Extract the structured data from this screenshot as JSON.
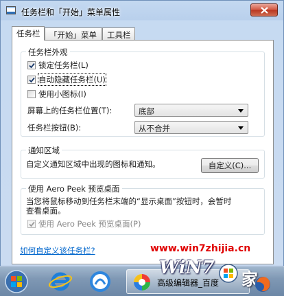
{
  "window": {
    "title": "任务栏和「开始」菜单属性"
  },
  "tabs": [
    {
      "label": "任务栏",
      "active": true
    },
    {
      "label": "「开始」菜单",
      "active": false
    },
    {
      "label": "工具栏",
      "active": false
    }
  ],
  "appearance": {
    "heading": "任务栏外观",
    "lock_taskbar": {
      "label": "锁定任务栏(L)",
      "checked": true
    },
    "auto_hide": {
      "label": "自动隐藏任务栏(U)",
      "checked": true
    },
    "small_icons": {
      "label": "使用小图标(I)",
      "checked": false
    },
    "location_label": "屏幕上的任务栏位置(T):",
    "location_value": "底部",
    "buttons_label": "任务栏按钮(B):",
    "buttons_value": "从不合并"
  },
  "notification": {
    "heading": "通知区域",
    "description": "自定义通知区域中出现的图标和通知。",
    "customize_button": "自定义(C)..."
  },
  "aero_peek": {
    "heading": "使用 Aero Peek 预览桌面",
    "description_line1": "当您将鼠标移动到任务栏末端的“显示桌面”按钮时，会暂时",
    "description_line2": "查看桌面。",
    "checkbox": {
      "label": "使用 Aero Peek 预览桌面(P)",
      "checked": true,
      "disabled": true
    }
  },
  "help_link": "如何自定义该任务栏?",
  "watermark": {
    "url": "www.win7zhijia.cn",
    "logo": "WiN7"
  },
  "taskbar": {
    "active_label": "高级编辑器_百度"
  },
  "colors": {
    "link": "#0066cc",
    "watermark": "#e00000",
    "close": "#c8462f"
  }
}
